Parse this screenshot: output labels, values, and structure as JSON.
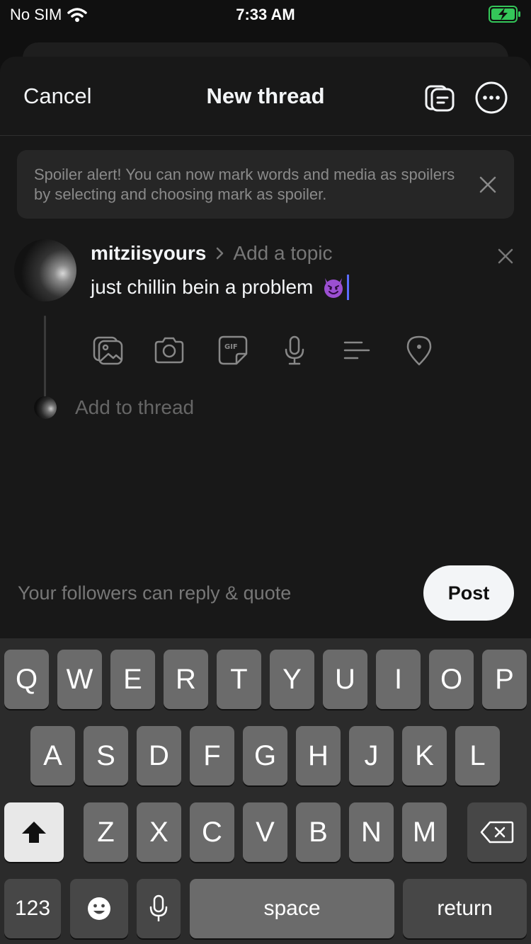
{
  "status_bar": {
    "carrier": "No SIM",
    "time": "7:33 AM"
  },
  "header": {
    "cancel_label": "Cancel",
    "title": "New thread"
  },
  "alert": {
    "text": "Spoiler alert! You can now mark words and media as spoilers by selecting and choosing mark as spoiler."
  },
  "post": {
    "username": "mitziisyours",
    "topic_placeholder": "Add a topic",
    "text": "just chillin bein a problem"
  },
  "toolbar": {
    "icons": [
      "gallery-icon",
      "camera-icon",
      "gif-icon",
      "microphone-icon",
      "poll-icon",
      "location-icon"
    ]
  },
  "add_thread": "Add to thread",
  "footer": {
    "reply_setting": "Your followers can reply & quote",
    "post_label": "Post"
  },
  "keyboard": {
    "row1": [
      "Q",
      "W",
      "E",
      "R",
      "T",
      "Y",
      "U",
      "I",
      "O",
      "P"
    ],
    "row2": [
      "A",
      "S",
      "D",
      "F",
      "G",
      "H",
      "J",
      "K",
      "L"
    ],
    "row3": [
      "Z",
      "X",
      "C",
      "V",
      "B",
      "N",
      "M"
    ],
    "numbers_label": "123",
    "space_label": "space",
    "return_label": "return"
  },
  "colors": {
    "background": "#181818",
    "accent_caret": "#5b6cff",
    "battery": "#34c759"
  }
}
